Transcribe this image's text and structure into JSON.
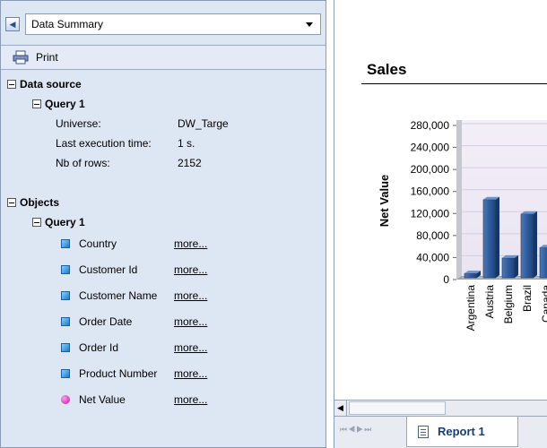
{
  "panel": {
    "selector_value": "Data Summary",
    "print_label": "Print"
  },
  "data_source": {
    "header": "Data source",
    "query_label": "Query 1",
    "rows": [
      {
        "key": "Universe:",
        "value": "DW_Targe"
      },
      {
        "key": "Last execution time:",
        "value": "1 s."
      },
      {
        "key": "Nb of rows:",
        "value": "2152"
      }
    ]
  },
  "objects": {
    "header": "Objects",
    "query_label": "Query 1",
    "items": [
      {
        "name": "Country",
        "more": "more...",
        "kind": "dimension"
      },
      {
        "name": "Customer Id",
        "more": "more...",
        "kind": "dimension"
      },
      {
        "name": "Customer Name",
        "more": "more...",
        "kind": "dimension"
      },
      {
        "name": "Order Date",
        "more": "more...",
        "kind": "dimension"
      },
      {
        "name": "Order Id",
        "more": "more...",
        "kind": "dimension"
      },
      {
        "name": "Product Number",
        "more": "more...",
        "kind": "dimension"
      },
      {
        "name": "Net Value",
        "more": "more...",
        "kind": "measure"
      }
    ]
  },
  "report": {
    "title": "Sales",
    "tab_label": "Report 1"
  },
  "chart_data": {
    "type": "bar",
    "title": "",
    "ylabel": "Net Value",
    "ylim": [
      0,
      280000
    ],
    "yticks": [
      "280,000",
      "240,000",
      "200,000",
      "160,000",
      "120,000",
      "80,000",
      "40,000",
      "0"
    ],
    "categories": [
      "Argentina",
      "Austria",
      "Belgium",
      "Brazil",
      "Canada"
    ],
    "values": [
      8000,
      142000,
      36000,
      116000,
      55000
    ],
    "bar_color": "#2f5b9b"
  },
  "colors": {
    "panel_bg": "#dde6f3",
    "accent": "#173e7a"
  }
}
